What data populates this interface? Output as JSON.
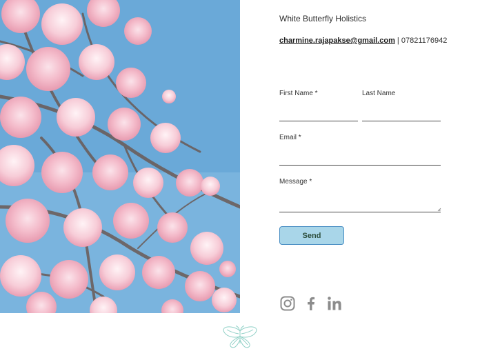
{
  "photo": {
    "subject": "pink cherry blossom branches against blue sky"
  },
  "business": {
    "name": "White Butterfly Holistics"
  },
  "contact": {
    "email": "charmine.rajapakse@gmail.com",
    "separator": " | ",
    "phone": "07821176942"
  },
  "form": {
    "first_name_label": "First Name *",
    "first_name_value": "",
    "last_name_label": "Last Name",
    "last_name_value": "",
    "email_label": "Email *",
    "email_value": "",
    "message_label": "Message *",
    "message_value": "",
    "send_label": "Send"
  },
  "social": [
    {
      "icon": "instagram-icon"
    },
    {
      "icon": "facebook-icon"
    },
    {
      "icon": "linkedin-icon"
    }
  ],
  "colors": {
    "button_fill": "#a9d6e9",
    "button_border": "#4a8fc4",
    "button_text": "#2d4f3e",
    "social_icon": "#8c8c8c",
    "logo": "#8fd0c6",
    "sky": "#6aa9d8",
    "blossom": "#f3b6c6"
  }
}
